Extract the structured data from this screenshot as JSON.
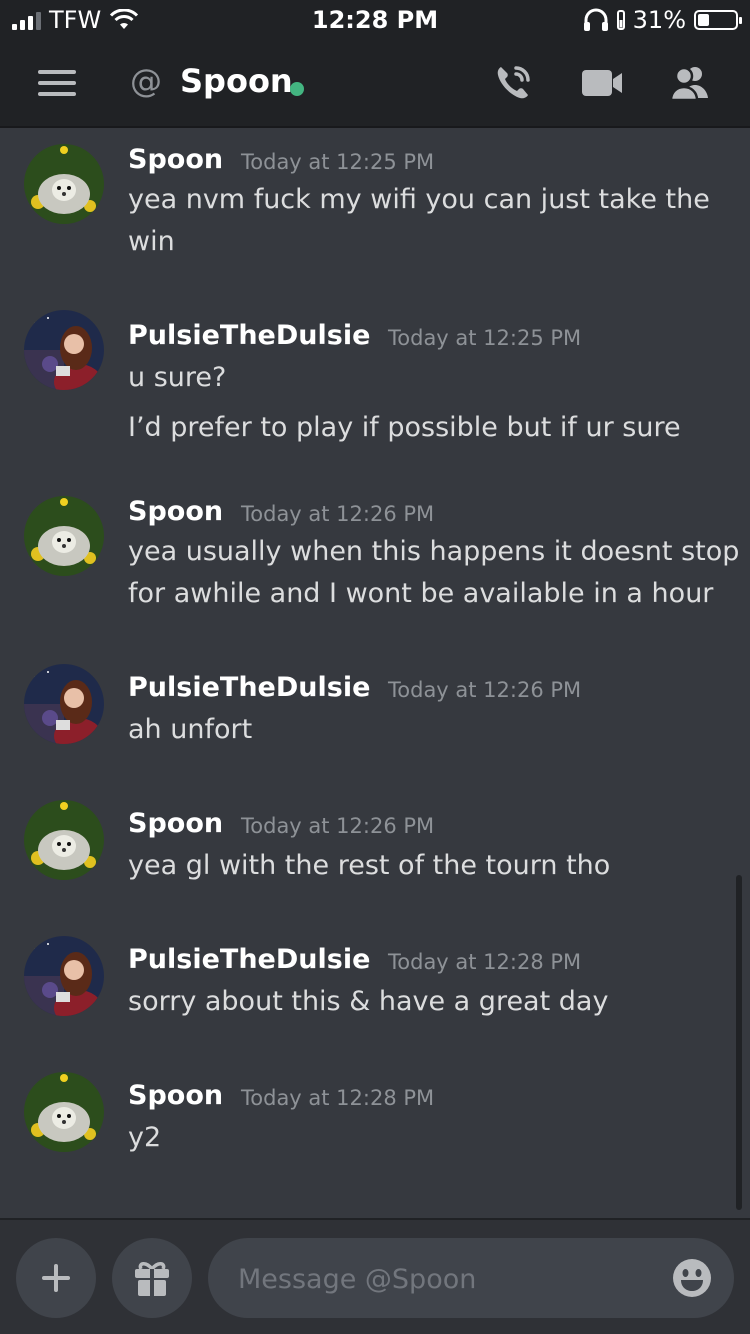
{
  "status_bar": {
    "carrier": "TFW",
    "time": "12:28 PM",
    "battery": "31%",
    "battery_level": 0.31
  },
  "header": {
    "at_symbol": "@",
    "title": "Spoon"
  },
  "messages": [
    {
      "author": "Spoon",
      "timestamp": "Today at 12:25 PM",
      "lines": [
        "yea nvm fuck my wifi you can just take the",
        "win"
      ]
    },
    {
      "author": "PulsieTheDulsie",
      "timestamp": "Today at 12:25 PM",
      "lines": [
        "u sure?",
        "I’d prefer to play if possible but if ur sure"
      ]
    },
    {
      "author": "Spoon",
      "timestamp": "Today at 12:26 PM",
      "lines": [
        "yea usually when this happens it doesnt stop",
        "for awhile and I wont be available in a hour"
      ]
    },
    {
      "author": "PulsieTheDulsie",
      "timestamp": "Today at 12:26 PM",
      "lines": [
        "ah unfort"
      ]
    },
    {
      "author": "Spoon",
      "timestamp": "Today at 12:26 PM",
      "lines": [
        "yea gl with the rest of the tourn tho"
      ]
    },
    {
      "author": "PulsieTheDulsie",
      "timestamp": "Today at 12:28 PM",
      "lines": [
        "sorry about this & have a great day"
      ]
    },
    {
      "author": "Spoon",
      "timestamp": "Today at 12:28 PM",
      "lines": [
        "y2"
      ]
    }
  ],
  "composer": {
    "placeholder": "Message @Spoon"
  },
  "icons": {
    "menu": "hamburger-icon",
    "call": "phone-call-icon",
    "video": "video-camera-icon",
    "members": "members-icon",
    "add": "plus-icon",
    "gift": "gift-icon",
    "emoji": "emoji-icon"
  },
  "colors": {
    "background": "#36393f",
    "header": "#202225",
    "online": "#43b581",
    "text": "#dcddde",
    "muted": "#8e9297"
  }
}
